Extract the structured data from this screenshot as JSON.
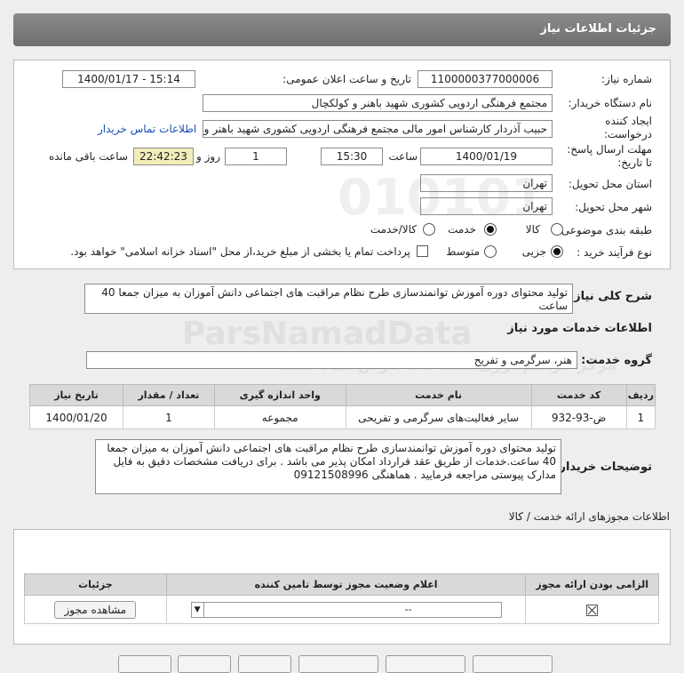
{
  "header": {
    "title": "جزئیات اطلاعات نیاز"
  },
  "form": {
    "need_number_label": "شماره نیاز:",
    "need_number": "1100000377000006",
    "announce_label": "تاریخ و ساعت اعلان عمومی:",
    "announce_value": "1400/01/17 - 15:14",
    "buyer_label": "نام دستگاه خریدار:",
    "buyer_value": "مجتمع فرهنگی اردویی کشوری شهید باهنر و کولکچال",
    "creator_label": "ایجاد کننده درخواست:",
    "creator_value": "حبیب آذردار کارشناس امور مالی  مجتمع فرهنگی اردویی کشوری شهید باهنر و",
    "contact_link": "اطلاعات تماس خریدار",
    "deadline_label": "مهلت ارسال پاسخ: تا تاریخ:",
    "deadline_date": "1400/01/19",
    "time_label": "ساعت",
    "deadline_time": "15:30",
    "days_value": "1",
    "days_label": "روز و",
    "remaining_time": "22:42:23",
    "remaining_label": "ساعت باقی مانده",
    "province_label": "استان محل تحویل:",
    "province_value": "تهران",
    "city_label": "شهر محل تحویل:",
    "city_value": "تهران",
    "category_label": "طبقه بندی موضوعی:",
    "category_options": [
      "کالا",
      "خدمت",
      "کالا/خدمت"
    ],
    "process_label": "نوع فرآیند خرید :",
    "process_options": [
      "جزیی",
      "متوسط"
    ],
    "payment_note": "پرداخت تمام یا بخشی از مبلغ خرید،از محل \"اسناد خزانه اسلامی\" خواهد بود."
  },
  "summary": {
    "label": "شرح کلی نیاز:",
    "text": "تولید محتوای دوره آموزش توانمندسازی طرح نظام مراقبت های اجتماعی دانش آموزان به میزان جمعا 40 ساعت"
  },
  "services": {
    "section_title": "اطلاعات خدمات مورد نیاز",
    "group_label": "گروه خدمت:",
    "group_value": "هنر، سرگرمی و تفریح",
    "columns": [
      "ردیف",
      "کد خدمت",
      "نام خدمت",
      "واحد اندازه گیری",
      "تعداد / مقدار",
      "تاریخ نیاز"
    ],
    "rows": [
      [
        "1",
        "ض-93-932",
        "سایر فعالیت‌های سرگرمی و تفریحی",
        "مجموعه",
        "1",
        "1400/01/20"
      ]
    ]
  },
  "buyer_notes": {
    "label": "توضیحات خریدار:",
    "text": "تولید محتوای دوره آموزش توانمندسازی طرح نظام مراقبت های اجتماعی دانش آموزان به میزان جمعا 40 ساعت.خدمات از طریق عقد قرارداد امکان پذیر می باشد . برای دریافت مشخصات دقیق به فایل مدارک پیوستی مراجعه فرمایید . هماهنگی 09121508996"
  },
  "permits": {
    "section_title": "اطلاعات مجوزهای ارائه خدمت / کالا",
    "columns": [
      "الزامی بودن ارائه مجوز",
      "اعلام وضعیت مجوز توسط تامین کننده",
      "جزئیات"
    ],
    "status_value": "--",
    "view_button": "مشاهده مجوز"
  },
  "watermark": {
    "digits": "010101",
    "brand": "ParsNamadData",
    "fa": "مرکز فراهم آوری اطلاعات پارس نماد داده"
  },
  "colors": {
    "header": "#7a7a7a",
    "link": "#1a4fb5",
    "time_box": "#f3edb9"
  }
}
